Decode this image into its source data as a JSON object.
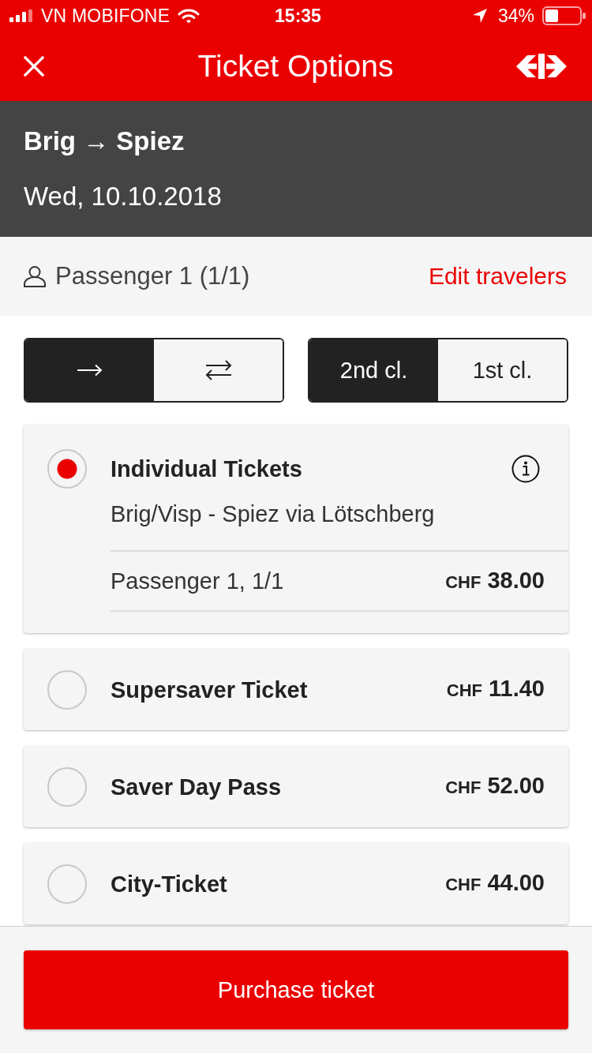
{
  "status_bar": {
    "carrier": "VN MOBIFONE",
    "time": "15:35",
    "battery": "34%"
  },
  "nav_bar": {
    "title": "Ticket Options"
  },
  "journey": {
    "route": "Brig → Spiez",
    "date": "Wed, 10.10.2018"
  },
  "travelers": {
    "summary": "Passenger 1 (1/1)",
    "edit_link": "Edit travelers"
  },
  "trip_type": [
    {
      "kind": "one-way",
      "selected": true
    },
    {
      "kind": "round-trip",
      "selected": false
    }
  ],
  "travel_class": [
    {
      "label": "2nd cl.",
      "selected": true
    },
    {
      "label": "1st cl.",
      "selected": false
    }
  ],
  "tickets": [
    {
      "title": "Individual Tickets",
      "selected": true,
      "expanded": true,
      "route": "Brig/Visp - Spiez via Lötschberg",
      "lines": [
        {
          "label": "Passenger 1, 1/1",
          "currency": "CHF",
          "amount": "38.00"
        }
      ]
    },
    {
      "title": "Supersaver Ticket",
      "selected": false,
      "expanded": false,
      "currency": "CHF",
      "amount": "11.40"
    },
    {
      "title": "Saver Day Pass",
      "selected": false,
      "expanded": false,
      "currency": "CHF",
      "amount": "52.00"
    },
    {
      "title": "City-Ticket",
      "selected": false,
      "expanded": false,
      "currency": "CHF",
      "amount": "44.00"
    }
  ],
  "purchase_button": "Purchase ticket"
}
